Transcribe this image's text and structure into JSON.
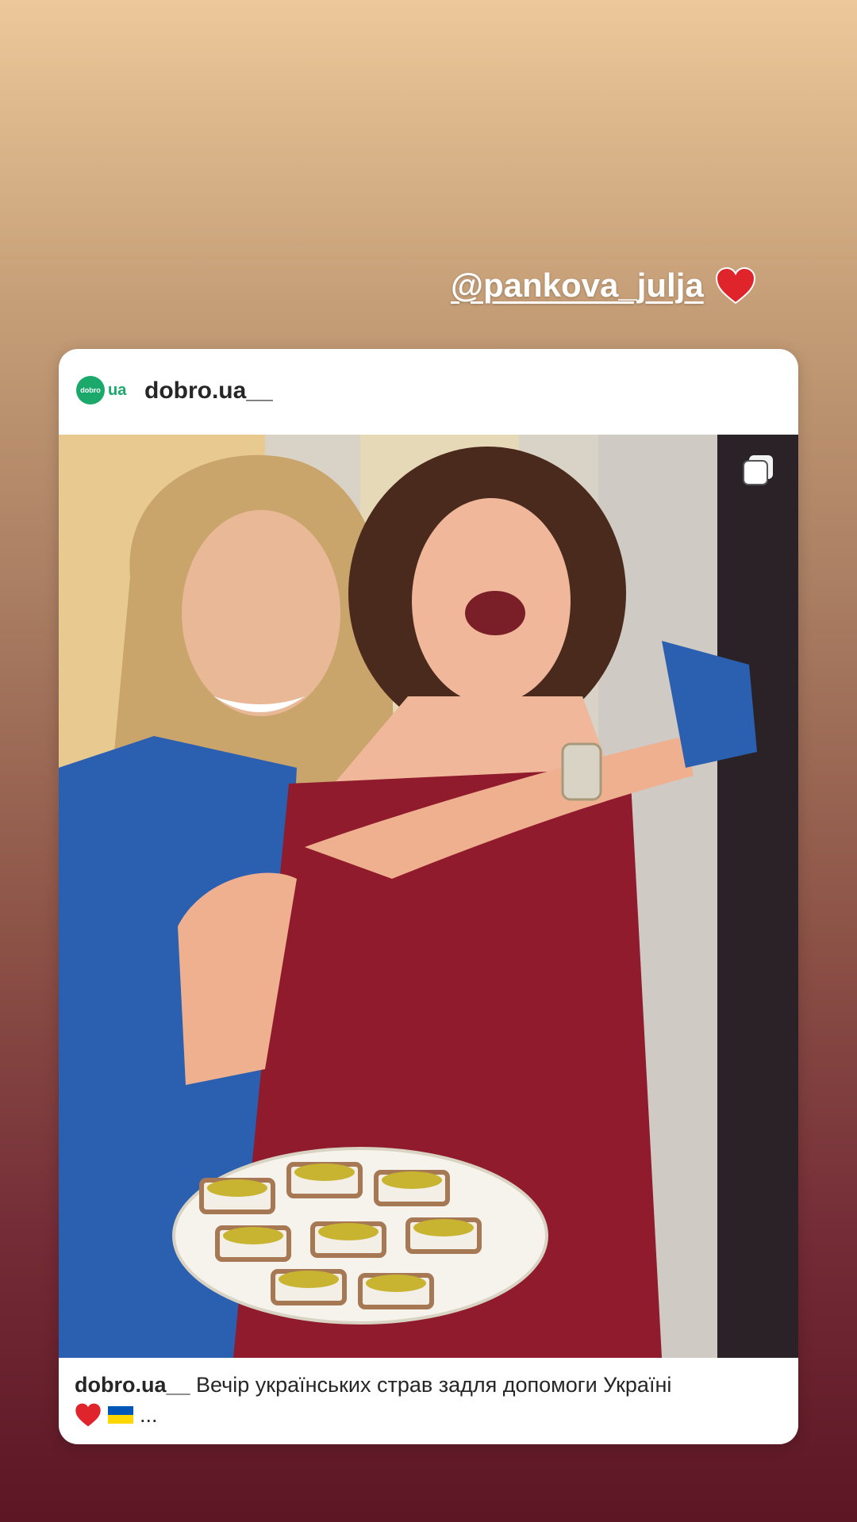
{
  "story": {
    "mention": "@pankova_julja",
    "mention_emoji": "heart-icon"
  },
  "post": {
    "logo_text": "dobro",
    "logo_suffix": "ua",
    "username": "dobro.ua__",
    "caption_user": "dobro.ua__",
    "caption_text": "Вечір українських страв задля допомоги Україні",
    "caption_more": "...",
    "caption_emojis": [
      "heart-icon",
      "ukraine-flag-icon"
    ],
    "media_indicator": "multiple-photos-icon",
    "photo_description_icon": "photo"
  },
  "colors": {
    "brand_green": "#1aa96a",
    "heart_red": "#e0242b",
    "flag_blue": "#0057b7",
    "flag_yellow": "#ffd700"
  }
}
